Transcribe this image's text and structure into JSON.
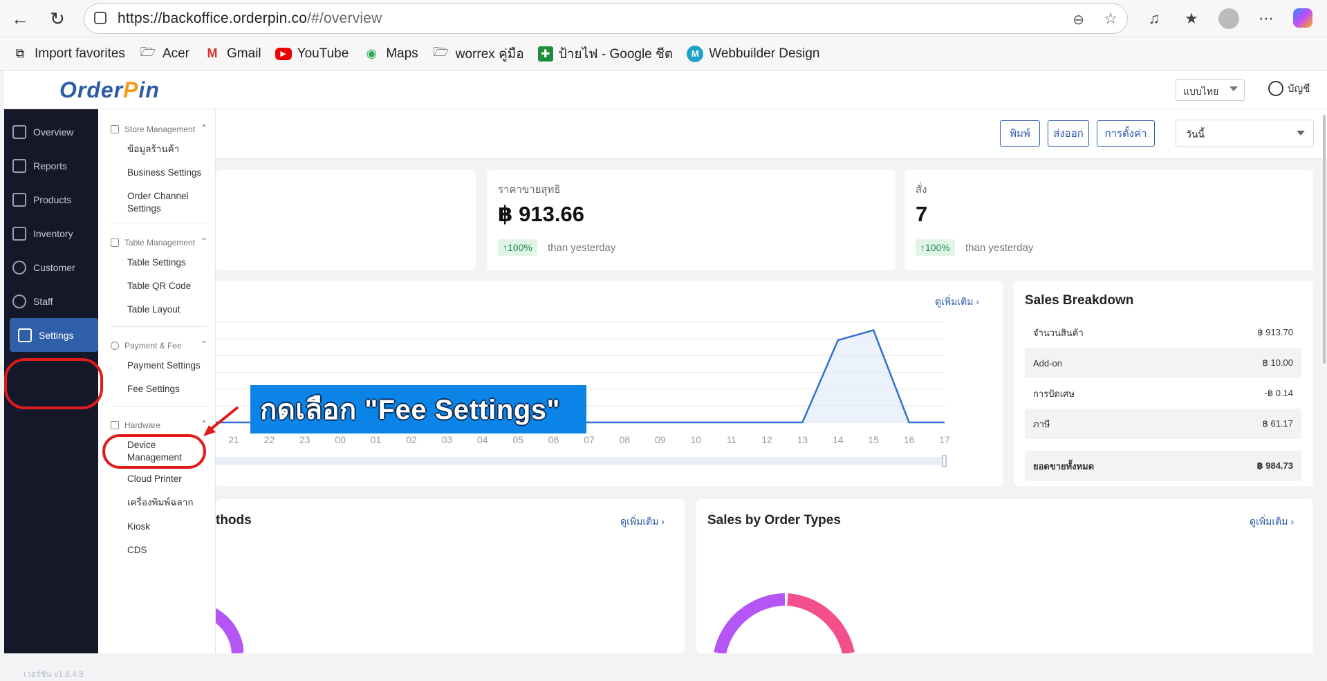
{
  "browser": {
    "url_main": "https://backoffice.orderpin.co",
    "url_hash": "/#/overview",
    "bookmarks": [
      {
        "label": "Import favorites",
        "icon": "import-icon"
      },
      {
        "label": "Acer",
        "icon": "folder-icon"
      },
      {
        "label": "Gmail",
        "icon": "gmail-icon"
      },
      {
        "label": "YouTube",
        "icon": "youtube-icon"
      },
      {
        "label": "Maps",
        "icon": "maps-icon"
      },
      {
        "label": "worrex คู่มือ",
        "icon": "folder-icon"
      },
      {
        "label": "ป้ายไฟ - Google ชีต",
        "icon": "sheets-icon"
      },
      {
        "label": "Webbuilder Design",
        "icon": "webbuilder-icon"
      }
    ]
  },
  "app": {
    "logo": {
      "pre": "Order",
      "o": "P",
      "post": "in"
    },
    "language": "แบบไทย",
    "account": "บัญชี",
    "version": "เวอร์ชัน v1.8.4.8"
  },
  "rail": {
    "items": [
      {
        "label": "Overview",
        "icon": "grid-icon"
      },
      {
        "label": "Reports",
        "icon": "report-icon"
      },
      {
        "label": "Products",
        "icon": "bag-icon"
      },
      {
        "label": "Inventory",
        "icon": "warehouse-icon"
      },
      {
        "label": "Customer",
        "icon": "users-icon"
      },
      {
        "label": "Staff",
        "icon": "staff-icon"
      },
      {
        "label": "Settings",
        "icon": "sliders-icon"
      }
    ]
  },
  "submenu": {
    "store_management": "Store Management",
    "store_info": "ข้อมูลร้านค้า",
    "business_settings": "Business Settings",
    "order_channel_settings": "Order Channel Settings",
    "table_management": "Table Management",
    "table_settings": "Table Settings",
    "table_qr_code": "Table QR Code",
    "table_layout": "Table Layout",
    "payment_fee": "Payment & Fee",
    "payment_settings": "Payment Settings",
    "fee_settings": "Fee Settings",
    "hardware": "Hardware",
    "device_management": "Device Management",
    "cloud_printer": "Cloud Printer",
    "label_printer": "เครื่องพิมพ์ฉลาก",
    "kiosk": "Kiosk",
    "cds": "CDS"
  },
  "toolbar": {
    "print": "พิมพ์",
    "export": "ส่งออก",
    "settings": "การตั้งค่า",
    "date_range": "วันนี้"
  },
  "kpis": [
    {
      "label": "ราคาขายสุทธิ",
      "value": "฿ 913.66",
      "change": "↑100%",
      "compare": "than yesterday"
    },
    {
      "label": "สั่ง",
      "value": "7",
      "change": "↑100%",
      "compare": "than yesterday"
    }
  ],
  "sales_chart": {
    "more": "ดูเพิ่มเติม",
    "x_labels": [
      "21",
      "22",
      "23",
      "00",
      "01",
      "02",
      "03",
      "04",
      "05",
      "06",
      "07",
      "08",
      "09",
      "10",
      "11",
      "12",
      "13",
      "14",
      "15",
      "16",
      "17"
    ]
  },
  "chart_data": {
    "type": "area",
    "x": [
      "21",
      "22",
      "23",
      "00",
      "01",
      "02",
      "03",
      "04",
      "05",
      "06",
      "07",
      "08",
      "09",
      "10",
      "11",
      "12",
      "13",
      "14",
      "15",
      "16",
      "17"
    ],
    "series": [
      {
        "values": [
          0,
          0,
          0,
          0,
          0,
          0,
          0,
          0,
          0,
          0,
          0,
          0,
          0,
          0,
          0,
          0,
          0,
          0.82,
          0.92,
          0,
          0
        ]
      }
    ],
    "grid": true
  },
  "breakdown": {
    "title": "Sales Breakdown",
    "rows": [
      {
        "label": "จำนวนสินค้า",
        "value": "฿ 913.70"
      },
      {
        "label": "Add-on",
        "value": "฿ 10.00"
      },
      {
        "label": "การปัดเศษ",
        "value": "-฿ 0.14"
      },
      {
        "label": "ภาษี",
        "value": "฿ 61.17"
      }
    ],
    "total_label": "ยอดขายทั้งหมด",
    "total_value": "฿ 984.73"
  },
  "payment_methods": {
    "title_partial": "thods",
    "more": "ดูเพิ่มเติม"
  },
  "order_types": {
    "title": "Sales by Order Types",
    "more": "ดูเพิ่มเติม"
  },
  "annotation": {
    "callout": "กดเลือก \"Fee Settings\"",
    "ring_color": "#e01b1b",
    "callout_color": "#0a84e6"
  }
}
